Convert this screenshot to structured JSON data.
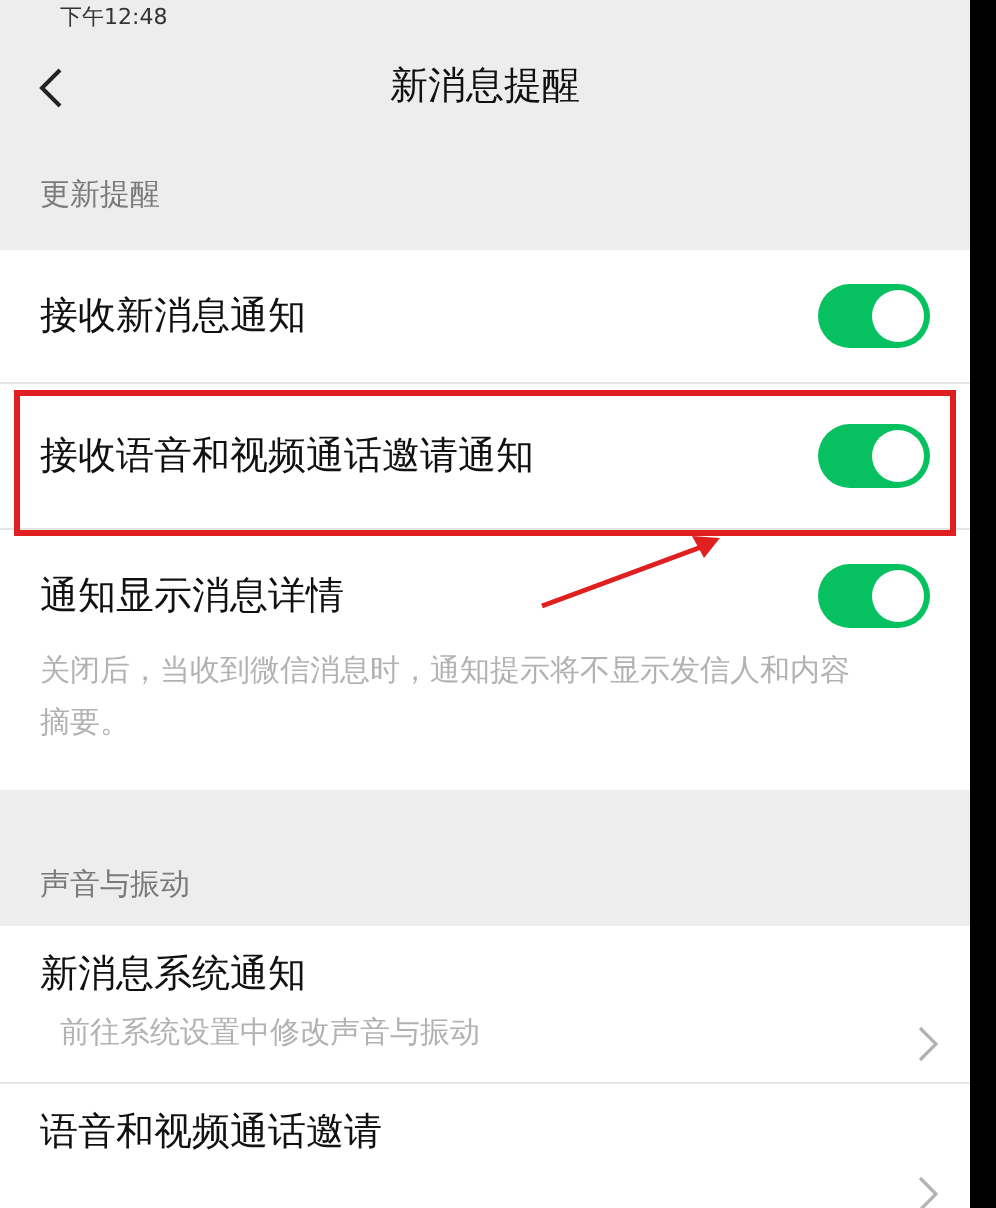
{
  "status_bar": {
    "time": "下午12:48"
  },
  "header": {
    "title": "新消息提醒"
  },
  "sections": [
    {
      "label": "更新提醒",
      "items": [
        {
          "kind": "toggle",
          "label": "接收新消息通知",
          "on": true,
          "highlighted": false
        },
        {
          "kind": "toggle",
          "label": "接收语音和视频通话邀请通知",
          "on": true,
          "highlighted": true
        },
        {
          "kind": "toggle",
          "label": "通知显示消息详情",
          "on": true,
          "highlighted": false,
          "description": "关闭后，当收到微信消息时，通知提示将不显示发信人和内容摘要。"
        }
      ]
    },
    {
      "label": "声音与振动",
      "items": [
        {
          "kind": "link",
          "label": "新消息系统通知",
          "subtitle": "前往系统设置中修改声音与振动"
        },
        {
          "kind": "link",
          "label": "语音和视频通话邀请"
        }
      ]
    }
  ]
}
